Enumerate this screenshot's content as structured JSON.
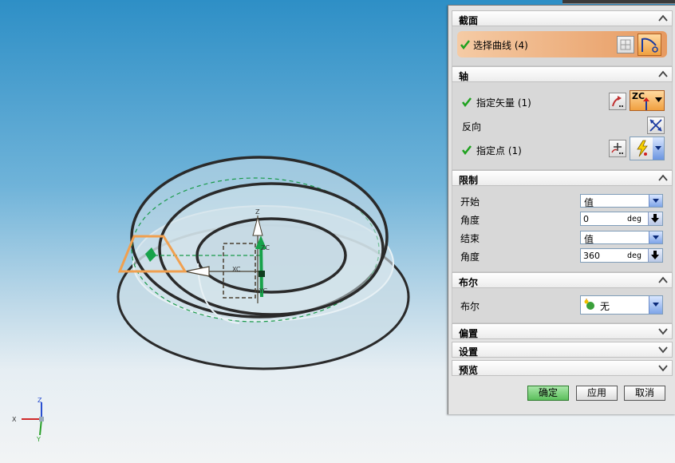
{
  "dialog": {
    "sections": {
      "section": {
        "title": "截面"
      },
      "axis": {
        "title": "轴"
      },
      "limits": {
        "title": "限制"
      },
      "boolean": {
        "title": "布尔"
      },
      "offset": {
        "title": "偏置"
      },
      "settings": {
        "title": "设置"
      },
      "preview": {
        "title": "预览"
      }
    },
    "select_curve": {
      "label": "选择曲线 (4)"
    },
    "specify_vector": {
      "label": "指定矢量 (1)",
      "dropdown_value": "ZC"
    },
    "reverse": {
      "label": "反向"
    },
    "specify_point": {
      "label": "指定点 (1)"
    },
    "limits": {
      "start_label": "开始",
      "start_value": "值",
      "start_angle_label": "角度",
      "start_angle_value": "0",
      "start_angle_unit": "deg",
      "end_label": "结束",
      "end_value": "值",
      "end_angle_label": "角度",
      "end_angle_value": "360",
      "end_angle_unit": "deg"
    },
    "boolean": {
      "label": "布尔",
      "value": "无"
    },
    "buttons": {
      "ok": "确定",
      "apply": "应用",
      "cancel": "取消"
    }
  },
  "viewport": {
    "axis_labels": {
      "z": "Z",
      "zc": "ZC",
      "xc": "XC",
      "yc": "YC",
      "triad_x": "X",
      "triad_y": "Y",
      "triad_z": "Z"
    }
  },
  "colors": {
    "accent_orange": "#f0a060",
    "check_green": "#1fa21f",
    "ok_green": "#6ec86e"
  }
}
